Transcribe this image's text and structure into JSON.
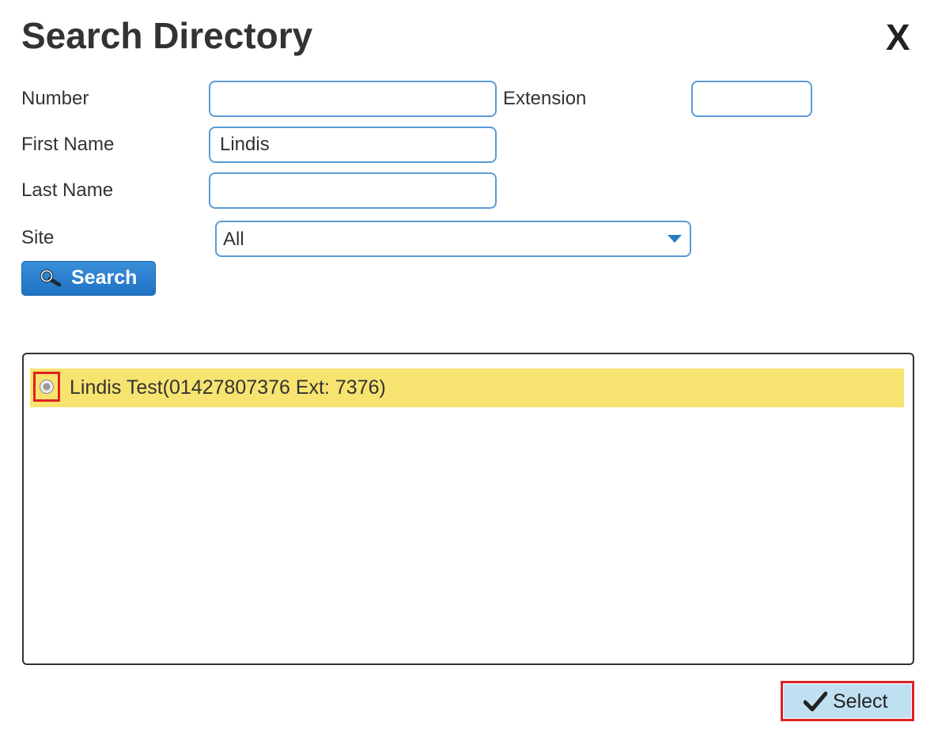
{
  "dialog": {
    "title": "Search Directory",
    "close_label": "X"
  },
  "form": {
    "number": {
      "label": "Number",
      "value": "",
      "placeholder": ""
    },
    "extension": {
      "label": "Extension",
      "value": "",
      "placeholder": ""
    },
    "first_name": {
      "label": "First Name",
      "value": "Lindis",
      "placeholder": ""
    },
    "last_name": {
      "label": "Last Name",
      "value": "",
      "placeholder": ""
    },
    "site": {
      "label": "Site",
      "selected": "All"
    },
    "search_button": {
      "label": "Search",
      "icon": "search-icon"
    }
  },
  "results": {
    "items": [
      {
        "text": "Lindis Test(01427807376 Ext: 7376)",
        "selected": true
      }
    ],
    "highlight_color": "#f7e36f"
  },
  "footer": {
    "select_button": {
      "label": "Select",
      "icon": "checkmark-icon"
    }
  },
  "colors": {
    "accent": "#2a7cc7",
    "field_border": "#5b9bd5",
    "annotation_red": "#e02020",
    "select_button_bg": "#bfe0f0"
  }
}
